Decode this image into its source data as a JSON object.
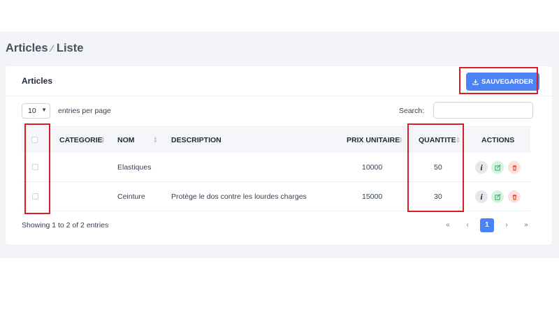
{
  "breadcrumb": {
    "section": "Articles",
    "separator": "⁄",
    "page": "Liste"
  },
  "card": {
    "title": "Articles",
    "save_label": "SAUVEGARDER"
  },
  "controls": {
    "page_length": "10",
    "length_label": "entries per page",
    "search_label": "Search:",
    "search_value": ""
  },
  "table": {
    "headers": {
      "categorie": "CATEGORIE",
      "nom": "NOM",
      "description": "DESCRIPTION",
      "prix": "PRIX UNITAIRE",
      "quantite": "QUANTITE",
      "actions": "ACTIONS"
    },
    "rows": [
      {
        "categorie": "",
        "nom": "Elastiques",
        "description": "",
        "prix": "10000",
        "quantite": "50"
      },
      {
        "categorie": "",
        "nom": "Ceinture",
        "description": "Protège le dos contre les lourdes charges",
        "prix": "15000",
        "quantite": "30"
      }
    ]
  },
  "footer": {
    "summary": "Showing 1 to 2 of 2 entries"
  },
  "pagination": {
    "first": "«",
    "prev": "‹",
    "current": "1",
    "next": "›",
    "last": "»"
  },
  "colors": {
    "primary": "#4b83f6",
    "highlight": "#e01a24",
    "edit_bg": "#d6f3e0",
    "delete_bg": "#fde0e0"
  },
  "icons": {
    "save": "download-icon",
    "info": "info-icon",
    "edit": "edit-icon",
    "delete": "trash-icon"
  }
}
